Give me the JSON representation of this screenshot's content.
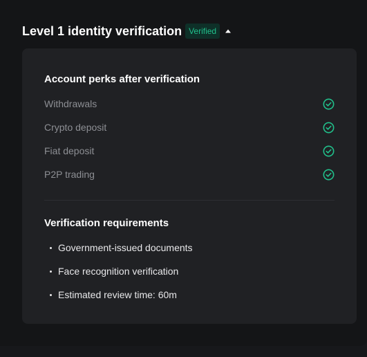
{
  "header": {
    "title": "Level 1 identity verification",
    "badge": "Verified"
  },
  "perks": {
    "title": "Account perks after verification",
    "items": [
      {
        "label": "Withdrawals",
        "status": "check-circle-icon"
      },
      {
        "label": "Crypto deposit",
        "status": "check-circle-icon"
      },
      {
        "label": "Fiat deposit",
        "status": "check-circle-icon"
      },
      {
        "label": "P2P trading",
        "status": "check-circle-icon"
      }
    ]
  },
  "requirements": {
    "title": "Verification requirements",
    "items": [
      {
        "label": "Government-issued documents"
      },
      {
        "label": "Face recognition verification"
      },
      {
        "label": "Estimated review time: 60m"
      }
    ]
  },
  "colors": {
    "background": "#141517",
    "card": "#202124",
    "accent_green": "#21c08b",
    "badge_bg": "#0e3028",
    "muted_text": "#8d8f94"
  }
}
